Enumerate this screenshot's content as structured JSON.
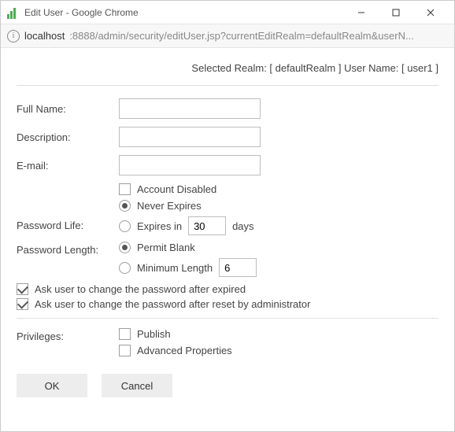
{
  "window": {
    "title": "Edit User - Google Chrome"
  },
  "address": {
    "host": "localhost",
    "path": ":8888/admin/security/editUser.jsp?currentEditRealm=defaultRealm&userN..."
  },
  "header": {
    "realm_line": "Selected Realm: [ defaultRealm ]   User Name: [ user1 ]"
  },
  "labels": {
    "full_name": "Full Name:",
    "description": "Description:",
    "email": "E-mail:",
    "password_life": "Password Life:",
    "password_length": "Password Length:",
    "privileges": "Privileges:"
  },
  "fields": {
    "full_name": "",
    "description": "",
    "email": "",
    "account_disabled_label": "Account Disabled",
    "never_expires_label": "Never Expires",
    "expires_in_label_pre": "Expires in",
    "expires_in_days": "30",
    "expires_in_label_post": "days",
    "permit_blank_label": "Permit Blank",
    "min_length_label": "Minimum Length",
    "min_length_value": "6",
    "ask_after_expired": "Ask user to change the password after expired",
    "ask_after_reset": "Ask user to change the password after reset by administrator",
    "priv_publish": "Publish",
    "priv_advanced": "Advanced Properties"
  },
  "buttons": {
    "ok": "OK",
    "cancel": "Cancel"
  }
}
